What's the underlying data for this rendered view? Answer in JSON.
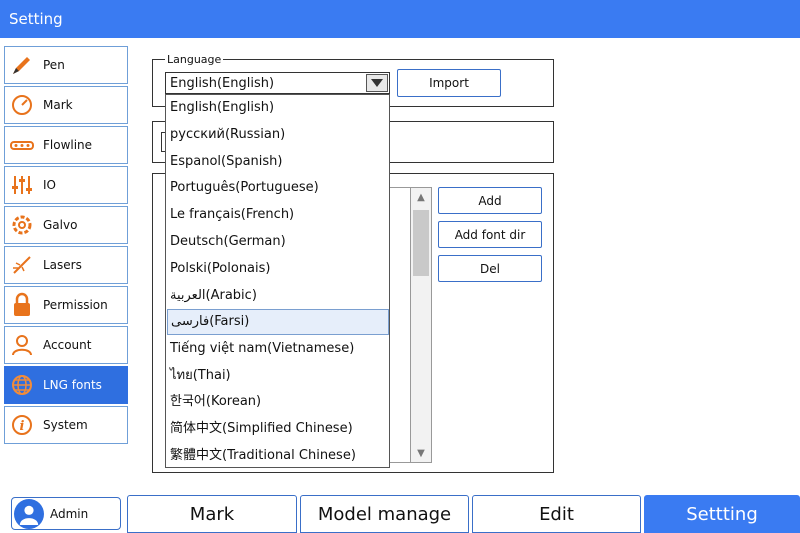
{
  "window": {
    "title": "Setting"
  },
  "sidebar": {
    "items": [
      {
        "label": "Pen",
        "icon": "pen-icon"
      },
      {
        "label": "Mark",
        "icon": "mark-gauge-icon"
      },
      {
        "label": "Flowline",
        "icon": "conveyor-icon"
      },
      {
        "label": "IO",
        "icon": "io-sliders-icon"
      },
      {
        "label": "Galvo",
        "icon": "gear-icon"
      },
      {
        "label": "Lasers",
        "icon": "laser-icon"
      },
      {
        "label": "Permission",
        "icon": "lock-icon"
      },
      {
        "label": "Account",
        "icon": "user-icon"
      },
      {
        "label": "LNG  fonts",
        "icon": "globe-icon",
        "active": true
      },
      {
        "label": "System",
        "icon": "info-icon"
      }
    ]
  },
  "language": {
    "group_title": "Language",
    "selected": "English(English)",
    "import_label": "Import",
    "options": [
      "English(English)",
      "русский(Russian)",
      "Espanol(Spanish)",
      "Português(Portuguese)",
      "Le français(French)",
      "Deutsch(German)",
      "Polski(Polonais)",
      "العربية(Arabic)",
      "فارسی(Farsi)",
      "Tiếng việt nam(Vietnamese)",
      "ไทย(Thai)",
      "한국어(Korean)",
      "简体中文(Simplified Chinese)",
      "繁體中文(Traditional Chinese)"
    ],
    "highlighted_index": 8
  },
  "fonts": {
    "add_label": "Add",
    "add_dir_label": "Add font dir",
    "del_label": "Del"
  },
  "user": {
    "name": "Admin"
  },
  "tabs": [
    {
      "label": "Mark"
    },
    {
      "label": "Model manage"
    },
    {
      "label": "Edit"
    },
    {
      "label": "Settting",
      "active": true
    }
  ],
  "colors": {
    "accent": "#3a7bf2",
    "active_sidebar": "#2f6fe0",
    "border": "#3a6fc8"
  }
}
